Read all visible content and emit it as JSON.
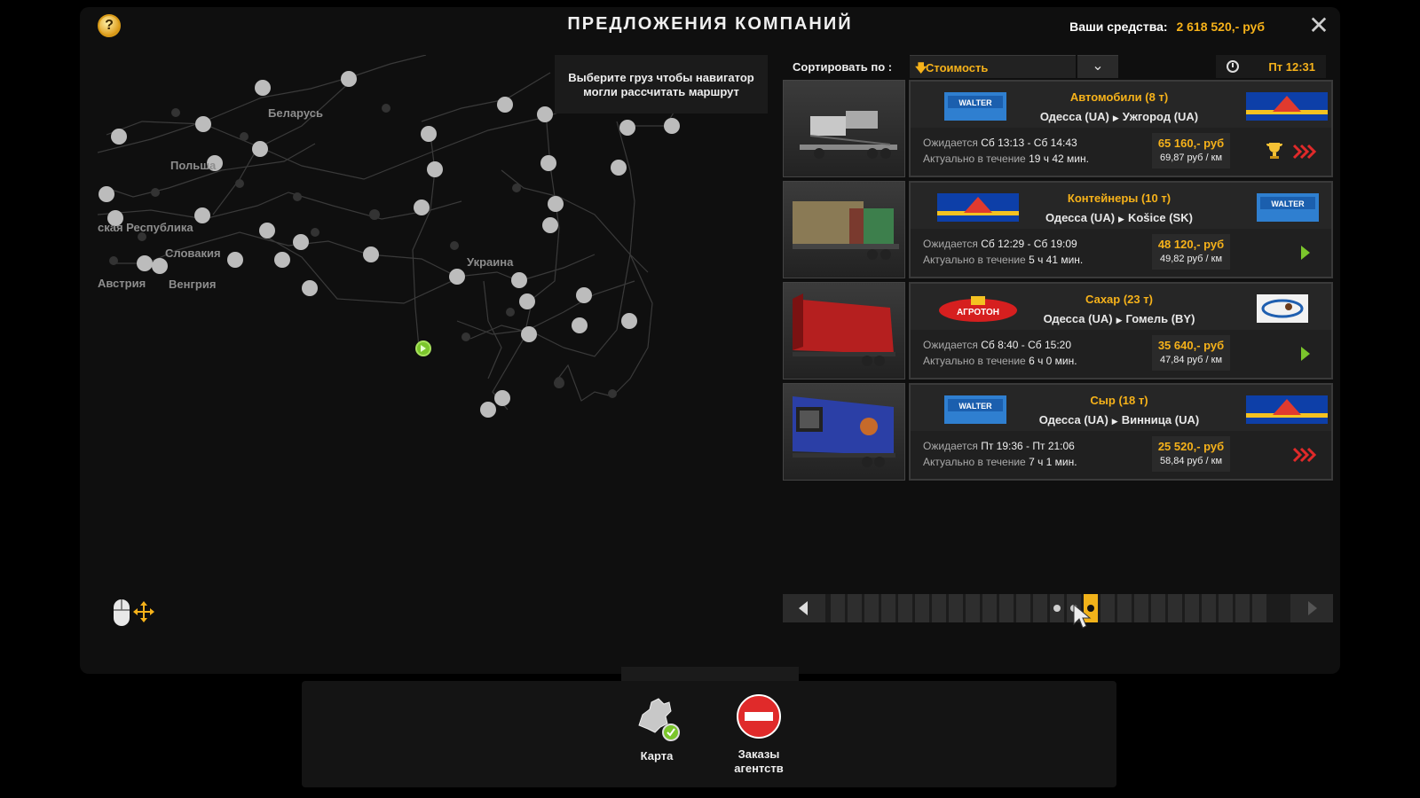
{
  "header": {
    "title": "ПРЕДЛОЖЕНИЯ КОМПАНИЙ",
    "funds_label": "Ваши средства:",
    "funds_amount": "2 618 520,- руб",
    "help_icon": "question-icon",
    "close_icon": "close-icon"
  },
  "map": {
    "labels": {
      "belarus": "Беларусь",
      "poland": "Польша",
      "czech": "ская Республика",
      "slovakia": "Словакия",
      "ukraine": "Украина",
      "austria": "Австрия",
      "hungary": "Венгрия"
    },
    "hint": "Выберите груз чтобы навигатор могли рассчитать маршрут"
  },
  "sort": {
    "label": "Сортировать по :",
    "value": "Стоимость"
  },
  "clock": {
    "time": "Пт 12:31"
  },
  "offers": [
    {
      "cargo": "Автомобили (8 т)",
      "from": "Одесса (UA)",
      "to": "Ужгород (UA)",
      "expires_key": "Ожидается",
      "expires": "Сб 13:13 - Сб 14:43",
      "valid_key": "Актуально в течение",
      "valid": "19 ч 42 мин.",
      "price": "65 160,- руб",
      "per_km": "69,87 руб / км",
      "urgency": "urgent",
      "trophy": true
    },
    {
      "cargo": "Контейнеры (10 т)",
      "from": "Одесса (UA)",
      "to": "Košice (SK)",
      "expires_key": "Ожидается",
      "expires": "Сб 12:29 - Сб 19:09",
      "valid_key": "Актуально в течение",
      "valid": "5 ч 41 мин.",
      "price": "48 120,- руб",
      "per_km": "49,82 руб / км",
      "urgency": "normal",
      "trophy": false
    },
    {
      "cargo": "Сахар (23 т)",
      "from": "Одесса (UA)",
      "to": "Гомель (BY)",
      "expires_key": "Ожидается",
      "expires": "Сб 8:40 - Сб 15:20",
      "valid_key": "Актуально в течение",
      "valid": "6 ч 0 мин.",
      "price": "35 640,- руб",
      "per_km": "47,84 руб / км",
      "urgency": "normal",
      "trophy": false
    },
    {
      "cargo": "Сыр (18 т)",
      "from": "Одесса (UA)",
      "to": "Винница (UA)",
      "expires_key": "Ожидается",
      "expires": "Пт 19:36 - Пт 21:06",
      "valid_key": "Актуально в течение",
      "valid": "7 ч 1 мин.",
      "price": "25 520,- руб",
      "per_km": "58,84 руб / км",
      "urgency": "urgent",
      "trophy": false
    }
  ],
  "pager": {
    "pages": 26,
    "current_page": 15
  },
  "bottom": {
    "map_label": "Карта",
    "agency_label": "Заказы агентств"
  },
  "colors": {
    "accent": "#f6b21a",
    "panel": "#0f0f0f",
    "card": "#202020",
    "go_green": "#7bc62c",
    "urgent_red": "#e02a2a"
  }
}
